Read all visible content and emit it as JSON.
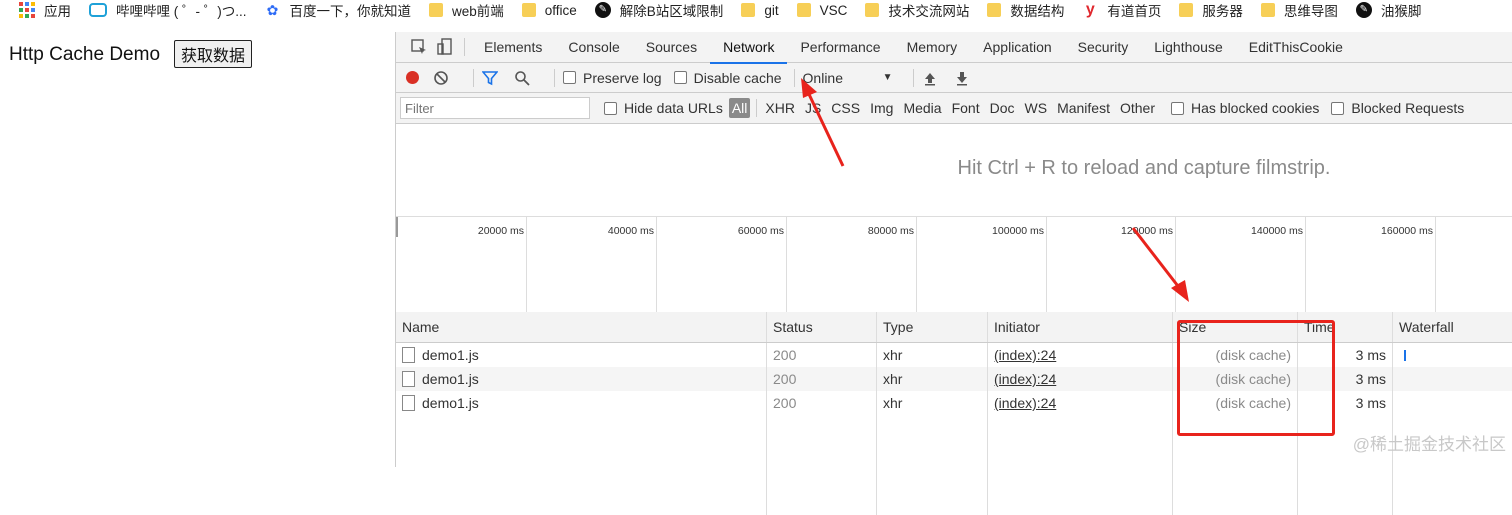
{
  "bookmarks": [
    {
      "label": "应用",
      "icon": "apps-grid-icon"
    },
    {
      "label": "哔哩哔哩 ( ゜- ゜)つ...",
      "icon": "bilibili-tv-icon"
    },
    {
      "label": "百度一下，你就知道",
      "icon": "baidu-paw-icon"
    },
    {
      "label": "web前端",
      "icon": "folder-icon"
    },
    {
      "label": "office",
      "icon": "folder-icon"
    },
    {
      "label": "解除B站区域限制",
      "icon": "circle-logo-icon"
    },
    {
      "label": "git",
      "icon": "folder-icon"
    },
    {
      "label": "VSC",
      "icon": "folder-icon"
    },
    {
      "label": "技术交流网站",
      "icon": "folder-icon"
    },
    {
      "label": "数据结构",
      "icon": "folder-icon"
    },
    {
      "label": "有道首页",
      "icon": "youdao-icon"
    },
    {
      "label": "服务器",
      "icon": "folder-icon"
    },
    {
      "label": "思维导图",
      "icon": "folder-icon"
    },
    {
      "label": "油猴脚",
      "icon": "circle-logo-icon"
    }
  ],
  "page": {
    "title": "Http Cache Demo",
    "button_label": "获取数据"
  },
  "devtools": {
    "tabs": [
      "Elements",
      "Console",
      "Sources",
      "Network",
      "Performance",
      "Memory",
      "Application",
      "Security",
      "Lighthouse",
      "EditThisCookie"
    ],
    "active_tab": "Network",
    "toolbar": {
      "preserve_log": "Preserve log",
      "disable_cache": "Disable cache",
      "throttling": "Online"
    },
    "filter": {
      "placeholder": "Filter",
      "hide_data_urls": "Hide data URLs",
      "types": [
        "All",
        "XHR",
        "JS",
        "CSS",
        "Img",
        "Media",
        "Font",
        "Doc",
        "WS",
        "Manifest",
        "Other"
      ],
      "has_blocked_cookies": "Has blocked cookies",
      "blocked_requests": "Blocked Requests"
    },
    "filmstrip_message": "Hit Ctrl + R to reload and capture filmstrip.",
    "overview_ticks": [
      "20000 ms",
      "40000 ms",
      "60000 ms",
      "80000 ms",
      "100000 ms",
      "120000 ms",
      "140000 ms",
      "160000 ms"
    ],
    "columns": [
      "Name",
      "Status",
      "Type",
      "Initiator",
      "Size",
      "Time",
      "Waterfall"
    ],
    "rows": [
      {
        "name": "demo1.js",
        "status": "200",
        "type": "xhr",
        "initiator": "(index):24",
        "size": "(disk cache)",
        "time": "3 ms"
      },
      {
        "name": "demo1.js",
        "status": "200",
        "type": "xhr",
        "initiator": "(index):24",
        "size": "(disk cache)",
        "time": "3 ms"
      },
      {
        "name": "demo1.js",
        "status": "200",
        "type": "xhr",
        "initiator": "(index):24",
        "size": "(disk cache)",
        "time": "3 ms"
      }
    ]
  },
  "watermark": "@稀土掘金技术社区",
  "colors": {
    "accent": "#1a73e8",
    "record": "#d93025",
    "annotation": "#e8231c"
  }
}
